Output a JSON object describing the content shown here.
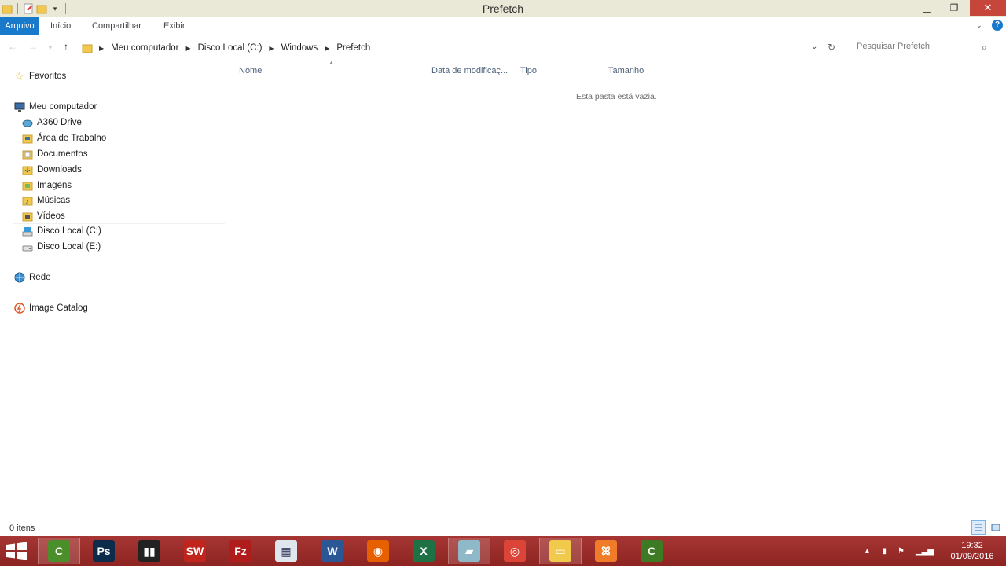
{
  "window": {
    "title": "Prefetch"
  },
  "ribbon": {
    "tabs": [
      "Arquivo",
      "Início",
      "Compartilhar",
      "Exibir"
    ]
  },
  "breadcrumb": [
    "Meu computador",
    "Disco Local (C:)",
    "Windows",
    "Prefetch"
  ],
  "search": {
    "placeholder": "Pesquisar Prefetch"
  },
  "navigation": {
    "favorites": "Favoritos",
    "computer": "Meu computador",
    "computer_items": [
      "A360 Drive",
      "Área de Trabalho",
      "Documentos",
      "Downloads",
      "Imagens",
      "Músicas",
      "Vídeos",
      "Disco Local (C:)",
      "Disco Local (E:)"
    ],
    "network": "Rede",
    "image_catalog": "Image Catalog"
  },
  "columns": {
    "name": "Nome",
    "modified": "Data de modificaç...",
    "type": "Tipo",
    "size": "Tamanho"
  },
  "content": {
    "empty_message": "Esta pasta está vazia."
  },
  "status": {
    "items": "0 itens"
  },
  "taskbar": {
    "apps": [
      {
        "name": "camtasia-recorder",
        "label": "C",
        "color": "#4b8f2a"
      },
      {
        "name": "photoshop",
        "label": "Ps",
        "color": "#0d2b4a"
      },
      {
        "name": "video-editor",
        "label": "▮▮",
        "color": "#222222"
      },
      {
        "name": "solidworks",
        "label": "SW",
        "color": "#c0241d"
      },
      {
        "name": "filezilla",
        "label": "Fz",
        "color": "#b01c1c"
      },
      {
        "name": "calculator",
        "label": "▦",
        "color": "#dfe6ee"
      },
      {
        "name": "word",
        "label": "W",
        "color": "#2b5797"
      },
      {
        "name": "firefox",
        "label": "◉",
        "color": "#e66000"
      },
      {
        "name": "excel",
        "label": "X",
        "color": "#1e7145"
      },
      {
        "name": "notes",
        "label": "▰",
        "color": "#8fb9c9"
      },
      {
        "name": "chrome",
        "label": "◎",
        "color": "#db4437"
      },
      {
        "name": "file-explorer",
        "label": "▭",
        "color": "#f1c94b"
      },
      {
        "name": "xampp",
        "label": "ꕤ",
        "color": "#f07c2a"
      },
      {
        "name": "camtasia-studio",
        "label": "C",
        "color": "#3d7a24"
      }
    ],
    "time": "19:32",
    "date": "01/09/2016"
  }
}
